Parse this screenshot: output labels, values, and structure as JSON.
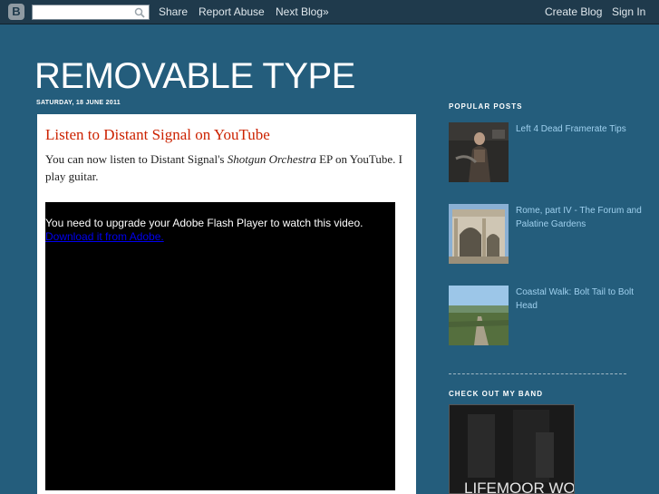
{
  "navbar": {
    "logo_letter": "B",
    "search": {
      "value": "",
      "placeholder": ""
    },
    "links": {
      "share": "Share",
      "report_abuse": "Report Abuse",
      "next_blog": "Next Blog»",
      "create_blog": "Create Blog",
      "sign_in": "Sign In"
    }
  },
  "blog": {
    "title": "REMOVABLE TYPE"
  },
  "post": {
    "date": "SATURDAY, 18 JUNE 2011",
    "title": "Listen to Distant Signal on YouTube",
    "body_before": "You can now listen to Distant Signal's ",
    "body_em": "Shotgun Orchestra",
    "body_after": " EP on YouTube. I play guitar.",
    "video": {
      "message": "You need to upgrade your Adobe Flash Player to watch this video.",
      "link": "Download it from Adobe."
    }
  },
  "sidebar": {
    "popular_heading": "POPULAR POSTS",
    "popular_posts": [
      {
        "title": "Left 4 Dead Framerate Tips",
        "thumb_icon": "game-character-thumbnail"
      },
      {
        "title": "Rome, part IV - The Forum and Palatine Gardens",
        "thumb_icon": "arch-thumbnail"
      },
      {
        "title": "Coastal Walk: Bolt Tail to Bolt Head",
        "thumb_icon": "landscape-thumbnail"
      }
    ],
    "band_heading": "CHECK OUT MY BAND",
    "band_image_text": "LIFEMOOR WO"
  },
  "colors": {
    "background": "#245d7c",
    "navbar": "#1f3a4c",
    "post_title": "#cc2200",
    "sidebar_link": "#9fd0ee"
  }
}
